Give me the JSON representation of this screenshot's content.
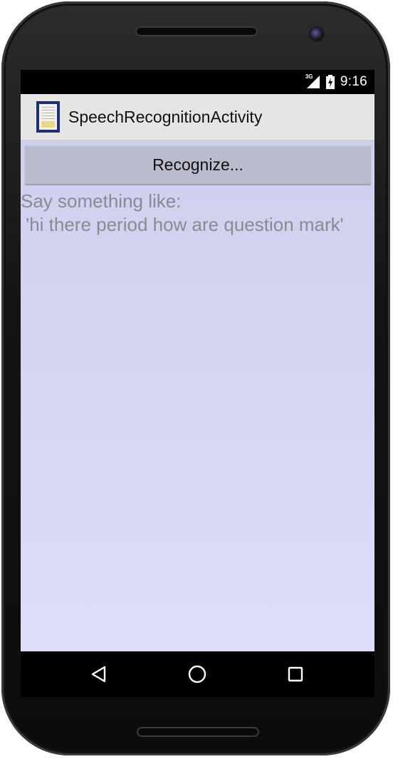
{
  "statusbar": {
    "network": "3G",
    "time": "9:16",
    "icons": [
      "signal-icon",
      "battery-charging-icon"
    ]
  },
  "actionbar": {
    "icon": "app-launcher-icon",
    "title": "SpeechRecognitionActivity"
  },
  "main": {
    "recognize_button": "Recognize...",
    "hint_line1": "Say something like:",
    "hint_line2": " 'hi there period how are question mark'"
  },
  "navbar": {
    "back": "back-icon",
    "home": "home-icon",
    "recents": "recents-icon"
  },
  "colors": {
    "content_bg": "#d3d4f1",
    "button_bg": "#babbcc",
    "hint_text": "#8a8a92",
    "actionbar_bg": "#e5e5e5"
  }
}
